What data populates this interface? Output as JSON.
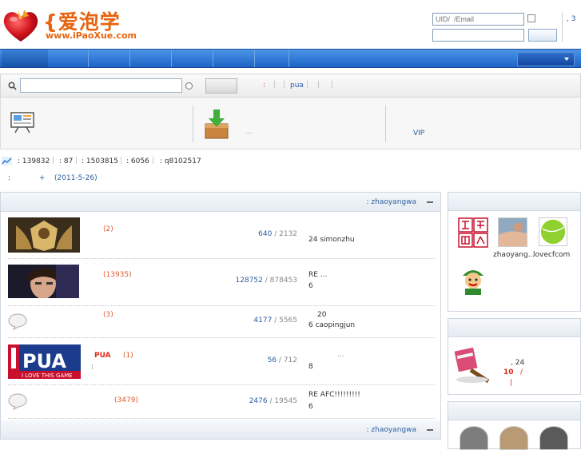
{
  "header": {
    "logo_cn": "{爱泡学",
    "logo_url": "www.iPaoXue.com",
    "login_placeholder": "UID/  /Email",
    "top_right": ", 3"
  },
  "searchbar": {
    "hot_prefix": ":",
    "hot_tag": "pua"
  },
  "band": {
    "item2_text": "...",
    "item3_text": "VIP"
  },
  "stats": {
    "a": ": 139832",
    "b": ": 87",
    "c": ": 1503815",
    "d": ": 6056",
    "e": ": q8102517"
  },
  "notice": {
    "colon": ":",
    "plus": "+",
    "date": "(2011-5-26)"
  },
  "forum": {
    "moderator_label": ": zhaoyangwa",
    "footer_moderator_label": ": zhaoyangwa",
    "rows": [
      {
        "title": "",
        "today": "(2)",
        "topics": "640",
        "posts": "2132",
        "last_line1": "",
        "last_line2": "24    simonzhu"
      },
      {
        "title": "",
        "today": "(13935)",
        "topics": "128752",
        "posts": "878453",
        "last_line1": "RE          ...",
        "last_line2": "6"
      },
      {
        "title": "",
        "today": "(3)",
        "topics": "4177",
        "posts": "5565",
        "last_line1": "20",
        "last_line2": "6    caopingjun"
      },
      {
        "title": "PUA",
        "today": "(1)",
        "topics": "56",
        "posts": "712",
        "last_line1": "...",
        "last_line2": "8",
        "note": ":"
      },
      {
        "title": "",
        "today": "(3479)",
        "topics": "2476",
        "posts": "19545",
        "last_line1": "RE    AFC!!!!!!!!!",
        "last_line2": "6"
      }
    ]
  },
  "sidebar": {
    "users": [
      {
        "name": ""
      },
      {
        "name": "zhaoyang..."
      },
      {
        "name": "lovecfcom"
      },
      {
        "name": ""
      }
    ],
    "box2": {
      "line1": ", 24",
      "line2_num": "10",
      "line2_slash": "/",
      "line3": "|"
    }
  }
}
